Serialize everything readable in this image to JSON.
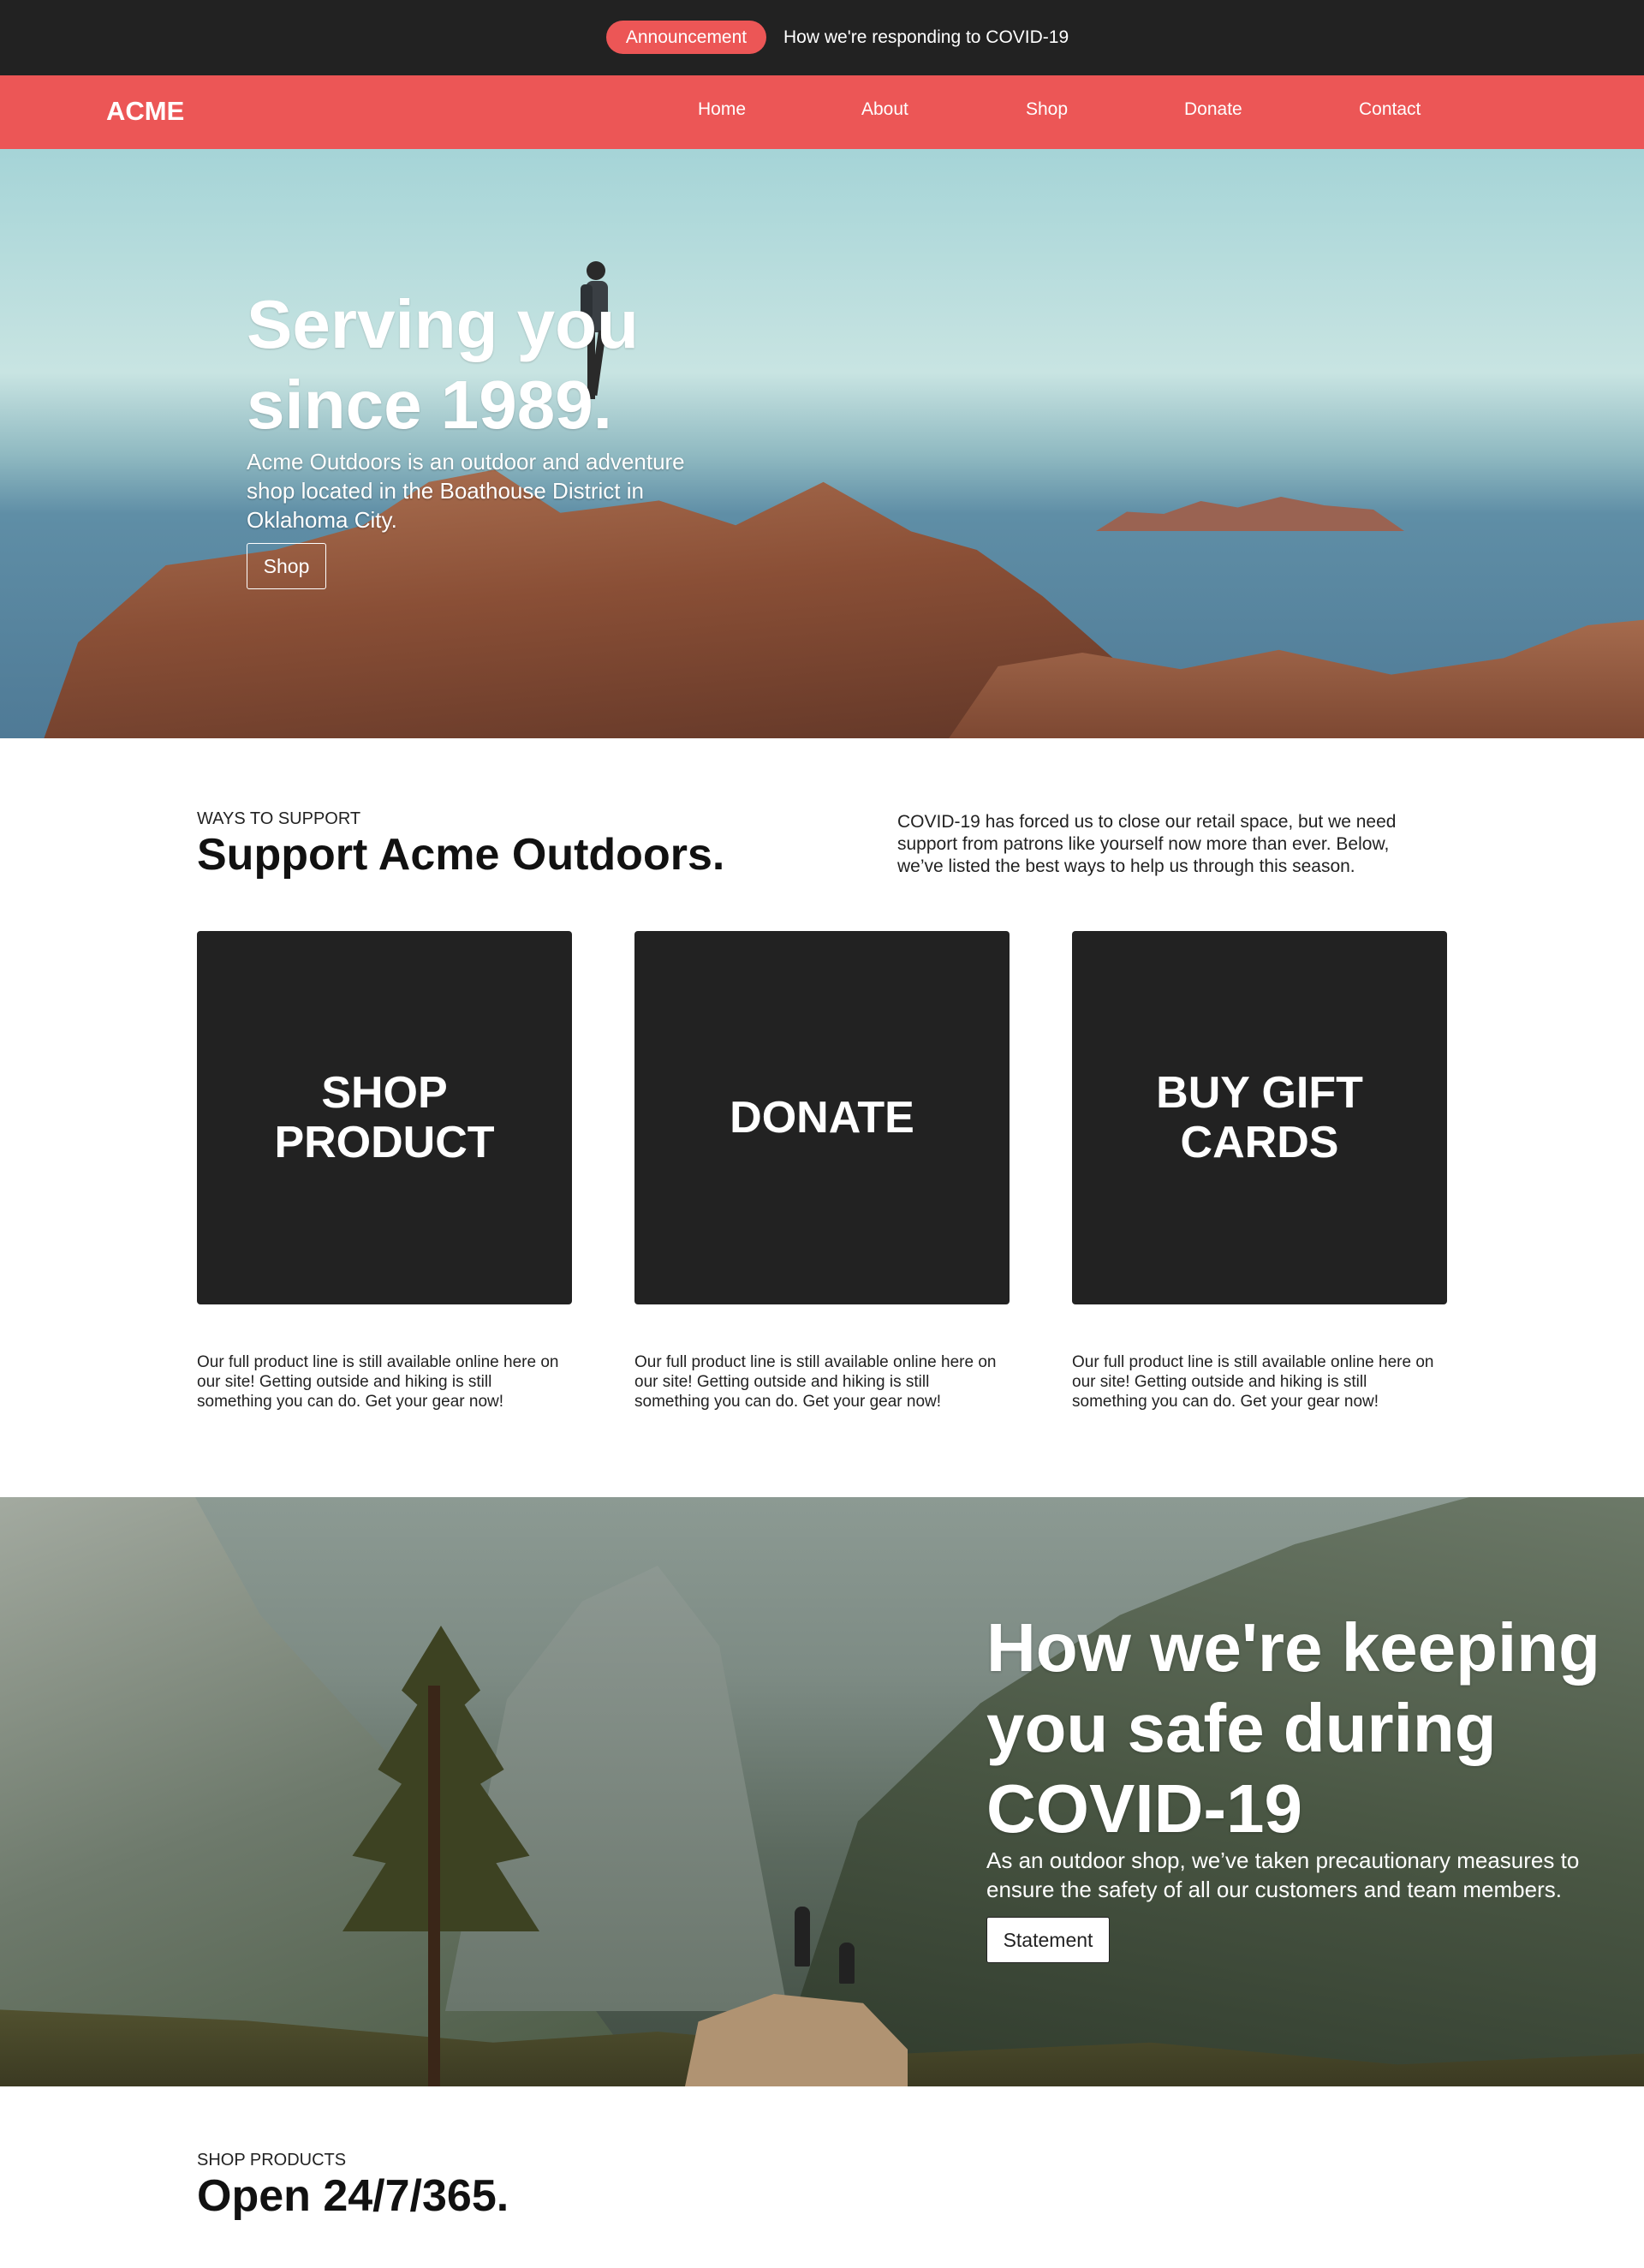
{
  "announcement": {
    "pill_label": "Announcement",
    "link_text": "How we're responding to COVID-19"
  },
  "nav": {
    "brand": "ACME",
    "items": [
      {
        "label": "Home"
      },
      {
        "label": "About"
      },
      {
        "label": "Shop"
      },
      {
        "label": "Donate"
      },
      {
        "label": "Contact"
      }
    ]
  },
  "hero": {
    "title": "Serving you since 1989.",
    "text": "Acme Outdoors is an outdoor and adventure shop located in the Boathouse District in Oklahoma City.",
    "button_label": "Shop"
  },
  "support": {
    "eyebrow": "WAYS TO SUPPORT",
    "title": "Support Acme Outdoors.",
    "description": "COVID-19 has forced us to close our retail space, but we need support from patrons like yourself now more than ever. Below, we’ve listed the best ways to help us through this season.",
    "cards": [
      {
        "title": "SHOP PRODUCT",
        "description": "Our full product line is still available online here on our site! Getting outside and hiking is still something you can do. Get your gear now!"
      },
      {
        "title": "DONATE",
        "description": "Our full product line is still available online here on our site! Getting outside and hiking is still something you can do. Get your gear now!"
      },
      {
        "title": "BUY GIFT CARDS",
        "description": "Our full product line is still available online here on our site! Getting outside and hiking is still something you can do. Get your gear now!"
      }
    ]
  },
  "covid": {
    "title": "How we're keeping you safe during COVID-19",
    "text": "As an outdoor shop, we’ve taken precautionary measures to ensure the safety of all our customers and team members.",
    "button_label": "Statement"
  },
  "shop_products": {
    "eyebrow": "SHOP PRODUCTS",
    "title": "Open 24/7/365."
  },
  "colors": {
    "accent": "#ec5656",
    "dark": "#222222",
    "white": "#ffffff"
  }
}
